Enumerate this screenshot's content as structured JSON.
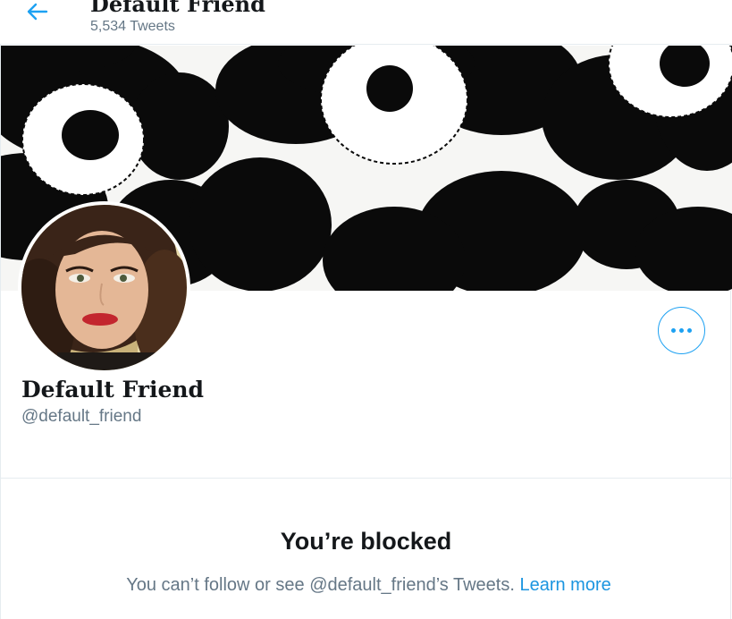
{
  "header": {
    "title": "Default Friend",
    "subtitle": "5,534 Tweets"
  },
  "icons": {
    "back": "arrow-left-icon",
    "more": "more-horizontal-icon"
  },
  "colors": {
    "accent": "#1da1f2",
    "link": "#1b95e0",
    "secondary_text": "#657786",
    "primary_text": "#14171a",
    "border": "#e6ecf0"
  },
  "profile": {
    "display_name": "Default Friend",
    "handle": "@default_friend"
  },
  "blocked": {
    "title": "You’re blocked",
    "message": "You can’t follow or see @default_friend’s Tweets.",
    "link": "Learn more"
  }
}
